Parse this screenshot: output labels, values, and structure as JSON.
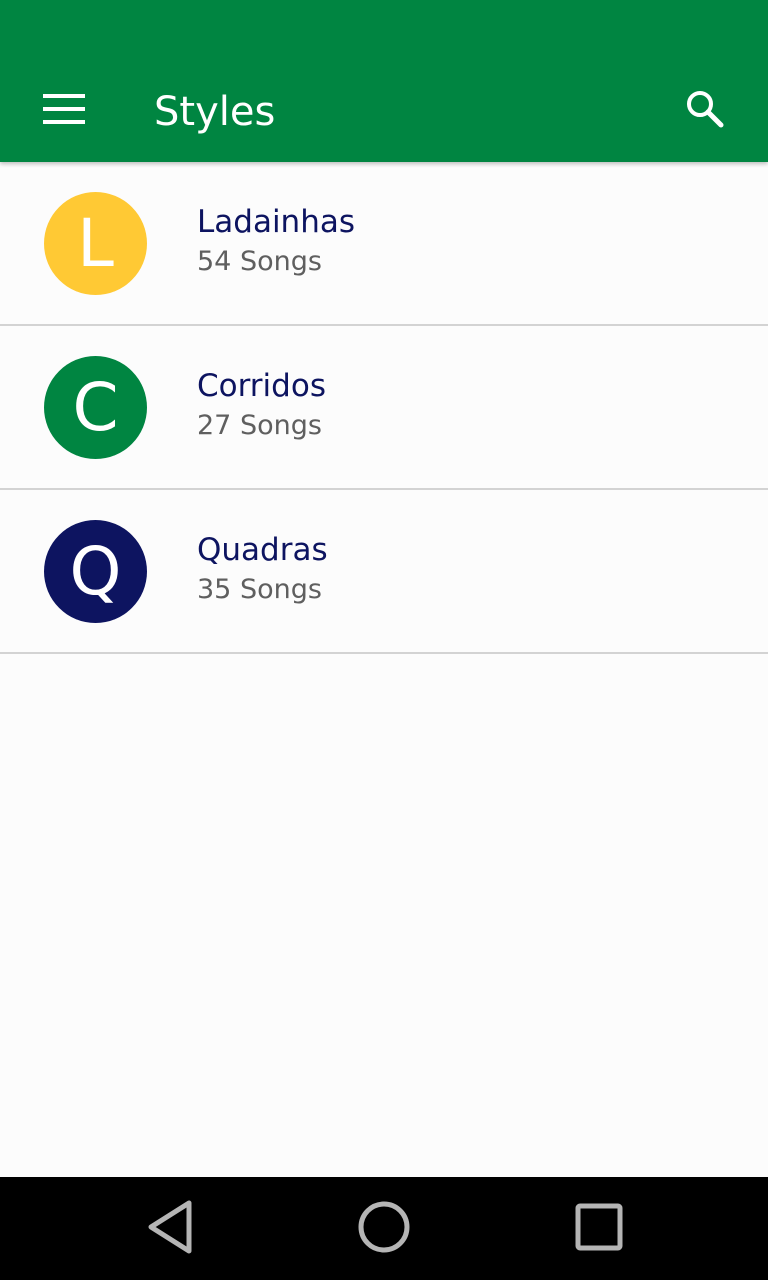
{
  "appbar": {
    "title": "Styles",
    "background_color": "#008541",
    "menu_icon": "hamburger-menu-icon",
    "search_icon": "search-icon"
  },
  "styles": [
    {
      "initial": "L",
      "name": "Ladainhas",
      "count": "54 Songs",
      "color": "#ffc934"
    },
    {
      "initial": "C",
      "name": "Corridos",
      "count": "27 Songs",
      "color": "#008541"
    },
    {
      "initial": "Q",
      "name": "Quadras",
      "count": "35 Songs",
      "color": "#0d1460"
    }
  ],
  "navbar": {
    "back_icon": "back-triangle-icon",
    "home_icon": "home-circle-icon",
    "recents_icon": "recents-square-icon"
  }
}
